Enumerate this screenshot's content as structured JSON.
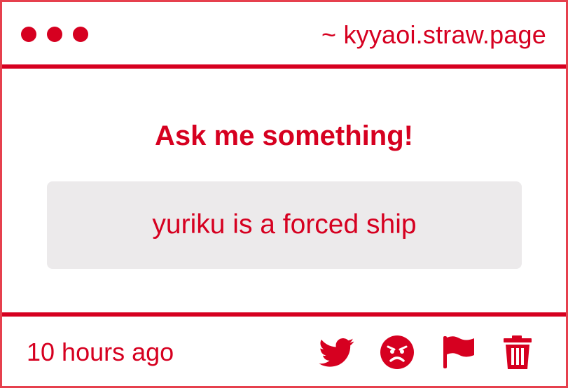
{
  "window": {
    "url": "~ kyyaoi.straw.page",
    "accent_color": "#d60020",
    "frame_color": "#e6404d"
  },
  "main": {
    "heading": "Ask me something!",
    "question": "yuriku is a forced ship"
  },
  "footer": {
    "timestamp": "10 hours ago",
    "actions": [
      {
        "icon": "twitter-icon"
      },
      {
        "icon": "angry-face-icon"
      },
      {
        "icon": "flag-icon"
      },
      {
        "icon": "trash-icon"
      }
    ]
  }
}
